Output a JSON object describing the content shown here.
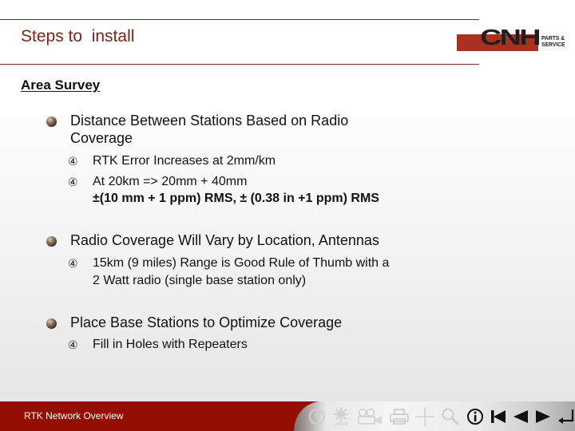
{
  "header": {
    "title": "Steps to  install",
    "logo": {
      "brand": "CNH",
      "subtitle_line1": "PARTS &",
      "subtitle_line2": "SERVICE",
      "accent_color": "#a8321f"
    },
    "rule_color": "#7a2a20",
    "title_color": "#7a2418"
  },
  "section": {
    "title": "Area Survey"
  },
  "bullets": [
    {
      "lines": [
        "Distance Between Stations Based on Radio",
        "Coverage"
      ],
      "sub_items": [
        {
          "marker": "④",
          "lines": [
            "RTK Error Increases at 2mm/km"
          ]
        },
        {
          "marker": "④",
          "lines": [
            "At 20km => 20mm + 40mm",
            "±(10 mm + 1 ppm) RMS, ± (0.38 in +1 ppm) RMS"
          ]
        }
      ]
    },
    {
      "lines": [
        "Radio Coverage Will Vary by Location, Antennas"
      ],
      "sub_items": [
        {
          "marker": "④",
          "lines": [
            "15km (9 miles) Range is Good Rule of Thumb with a",
            "2 Watt radio (single base station only)"
          ]
        }
      ]
    },
    {
      "lines": [
        "Place Base Stations to Optimize Coverage"
      ],
      "sub_items": [
        {
          "marker": "④",
          "lines": [
            "Fill in Holes with Repeaters"
          ]
        }
      ]
    }
  ],
  "footer": {
    "label": "RTK Network Overview",
    "background_color": "#920f00",
    "toolbar": [
      {
        "icon": "help-icon",
        "enabled": false
      },
      {
        "icon": "parts-gear-icon",
        "enabled": false
      },
      {
        "icon": "film-camera-icon",
        "enabled": false
      },
      {
        "icon": "print-icon",
        "enabled": false
      },
      {
        "icon": "crosshair-icon",
        "enabled": false
      },
      {
        "icon": "search-icon",
        "enabled": false
      },
      {
        "icon": "info-icon",
        "enabled": true
      },
      {
        "icon": "first-page-icon",
        "enabled": true
      },
      {
        "icon": "previous-icon",
        "enabled": true
      },
      {
        "icon": "next-icon",
        "enabled": true
      },
      {
        "icon": "return-icon",
        "enabled": true
      },
      {
        "icon": "home-icon",
        "enabled": true
      }
    ]
  }
}
